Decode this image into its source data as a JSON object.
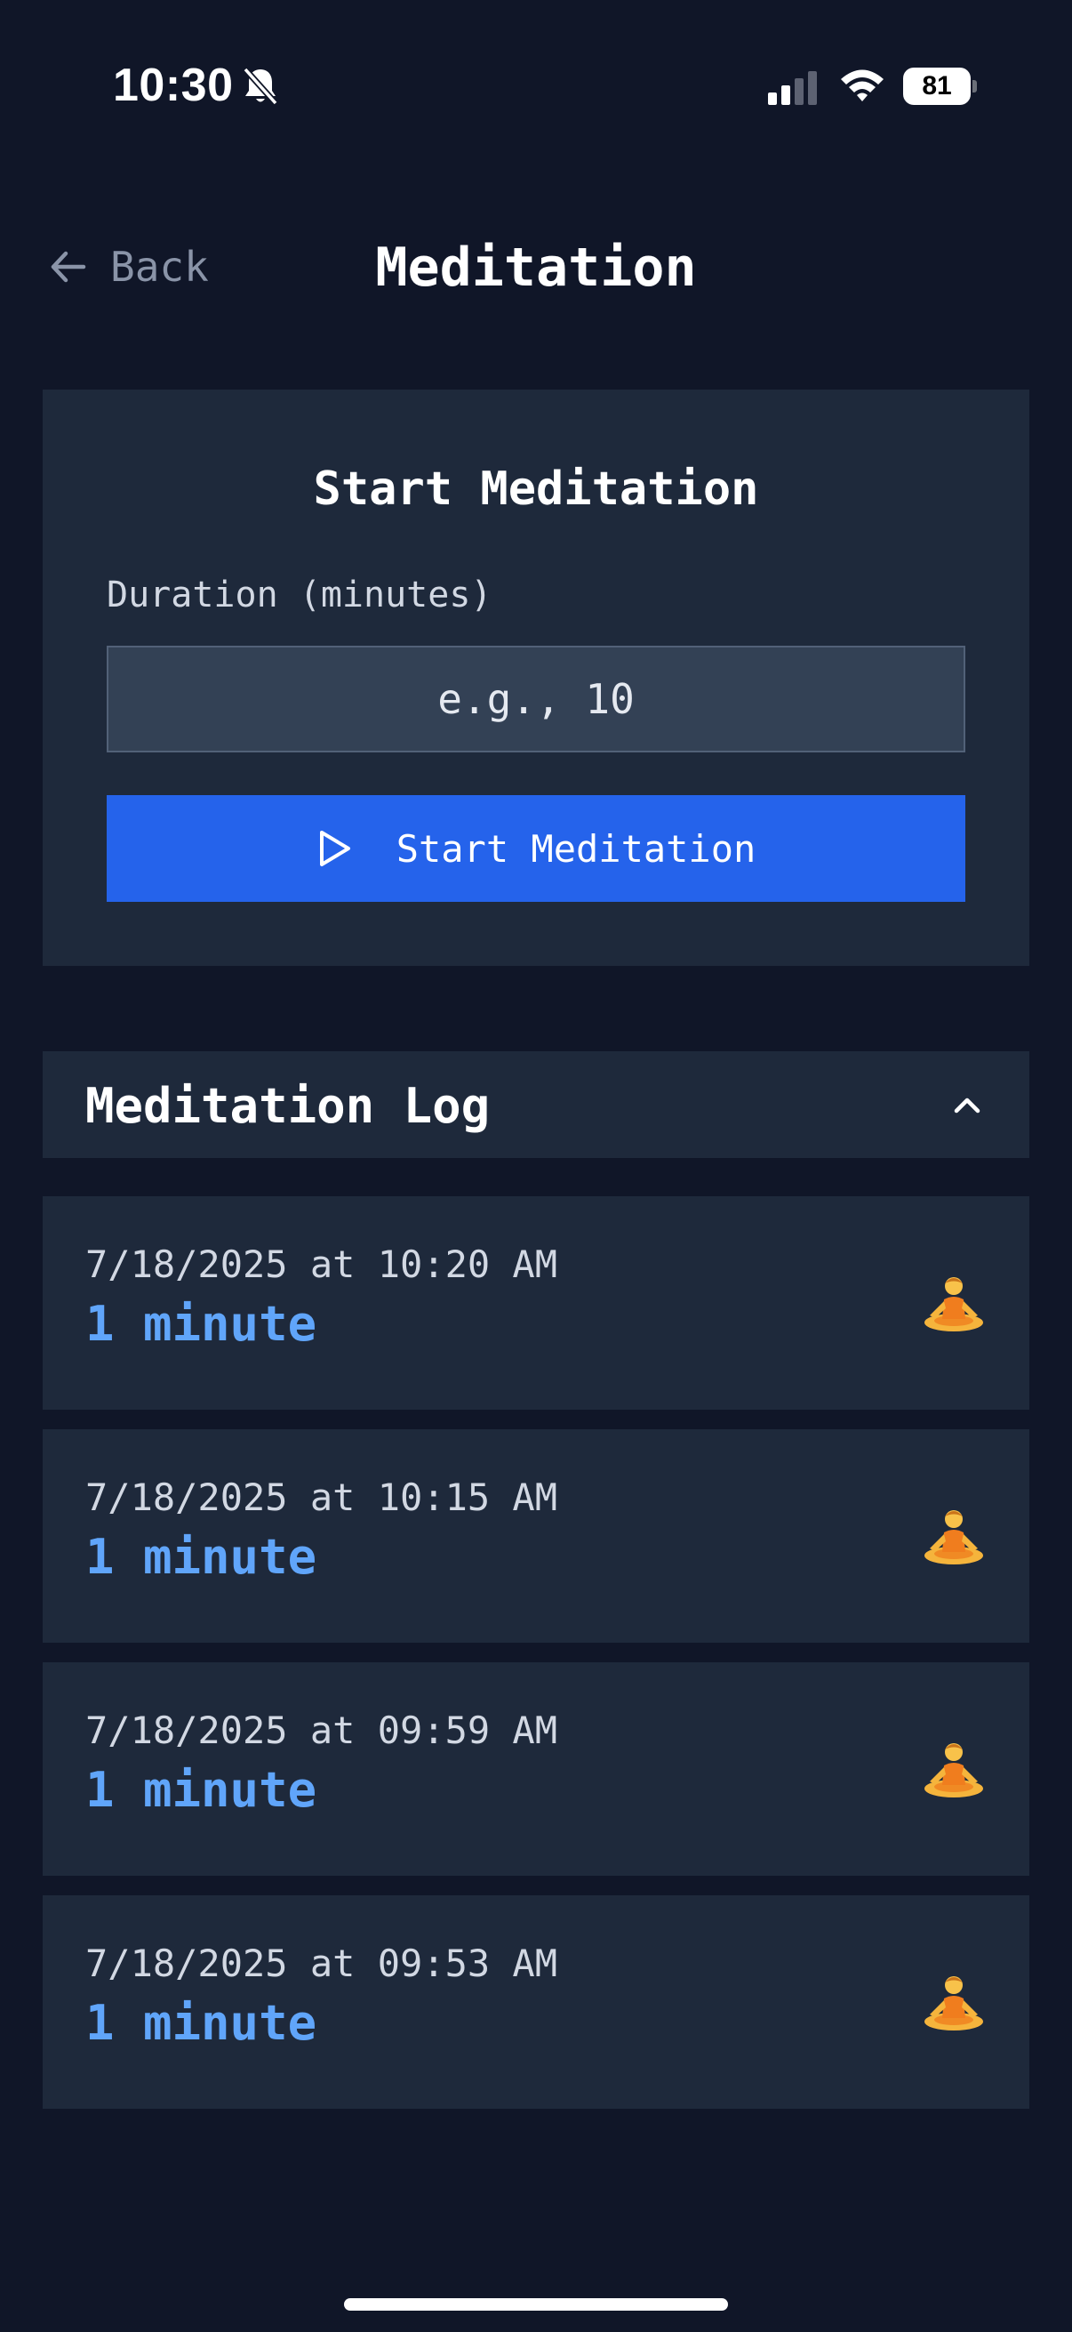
{
  "status_bar": {
    "time": "10:30",
    "battery": "81"
  },
  "header": {
    "back_label": "Back",
    "title": "Meditation"
  },
  "start_card": {
    "title": "Start Meditation",
    "duration_label": "Duration (minutes)",
    "duration_placeholder": "e.g., 10",
    "duration_value": "",
    "button_label": "Start Meditation"
  },
  "log": {
    "title": "Meditation Log",
    "entries": [
      {
        "date": "7/18/2025 at 10:20 AM",
        "duration": "1 minute"
      },
      {
        "date": "7/18/2025 at 10:15 AM",
        "duration": "1 minute"
      },
      {
        "date": "7/18/2025 at 09:59 AM",
        "duration": "1 minute"
      },
      {
        "date": "7/18/2025 at 09:53 AM",
        "duration": "1 minute"
      }
    ]
  },
  "icons": {
    "back": "arrow-left-icon",
    "play": "play-icon",
    "collapse": "chevron-up-icon",
    "entry": "lotus-position-icon"
  },
  "colors": {
    "background": "#101628",
    "card": "#1e293b",
    "accent": "#2563eb",
    "duration_text": "#60a5fa"
  }
}
